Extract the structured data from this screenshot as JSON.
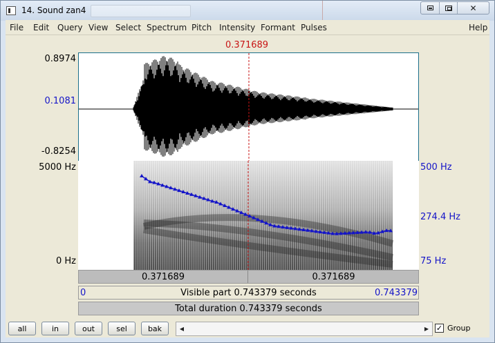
{
  "window": {
    "title": "14. Sound zan4",
    "controls": {
      "minimize": "minimize-icon",
      "maximize": "maximize-icon",
      "close": "✕"
    }
  },
  "menu": [
    "File",
    "Edit",
    "Query",
    "View",
    "Select",
    "Spectrum",
    "Pitch",
    "Intensity",
    "Formant",
    "Pulses",
    "Help"
  ],
  "cursor": {
    "time_label": "0.371689"
  },
  "waveform": {
    "ymax_label": "0.8974",
    "ymid_label": "0.1081",
    "ymin_label": "-0.8254"
  },
  "spectrogram": {
    "freq_top_label": "5000 Hz",
    "freq_bottom_label": "0 Hz",
    "pitch_top_label": "500 Hz",
    "pitch_mid_label": "274.4 Hz",
    "pitch_bottom_label": "75 Hz"
  },
  "time_bar": {
    "left_label": "0.371689",
    "right_label": "0.371689"
  },
  "visible_bar": {
    "start_label": "0",
    "text": "Visible part 0.743379 seconds",
    "end_label": "0.743379"
  },
  "total_bar": {
    "text": "Total duration 0.743379 seconds"
  },
  "buttons": {
    "all": "all",
    "in": "in",
    "out": "out",
    "sel": "sel",
    "bak": "bak"
  },
  "group": {
    "label": "Group",
    "checked": "✓"
  },
  "colors": {
    "cursor": "#c81414",
    "pitch": "#1414c8",
    "panel_border": "#1a6e8a"
  }
}
